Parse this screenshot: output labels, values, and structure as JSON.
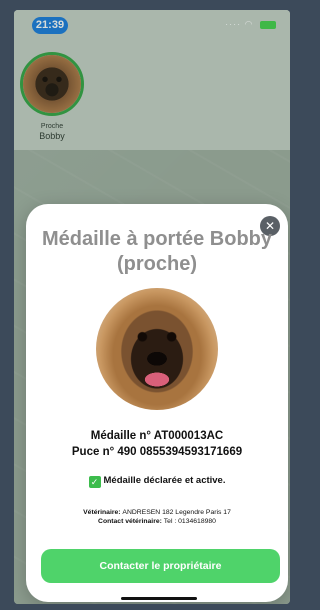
{
  "status_bar": {
    "time": "21:39"
  },
  "companion": {
    "role": "Proche",
    "name": "Bobby"
  },
  "card": {
    "title": "Médaille à portée Bobby (proche)",
    "medal_line": "Médaille n° AT000013AC",
    "chip_line": "Puce n° 490 0855394593171669",
    "declared_status": "Médaille déclarée et active.",
    "vet_label": "Vétérinaire:",
    "vet_value": "ANDRESEN  182 Legendre Paris 17",
    "vet_contact_label": "Contact vétérinaire:",
    "vet_contact_value": "Tel : 0134618980",
    "contact_button": "Contacter le propriétaire"
  },
  "icons": {
    "close": "close-icon",
    "check": "check-icon",
    "wifi": "wifi-icon",
    "battery": "battery-icon"
  },
  "colors": {
    "accent_green": "#4fd36a",
    "time_pill": "#1a7de0",
    "avatar_ring": "#35a646"
  }
}
